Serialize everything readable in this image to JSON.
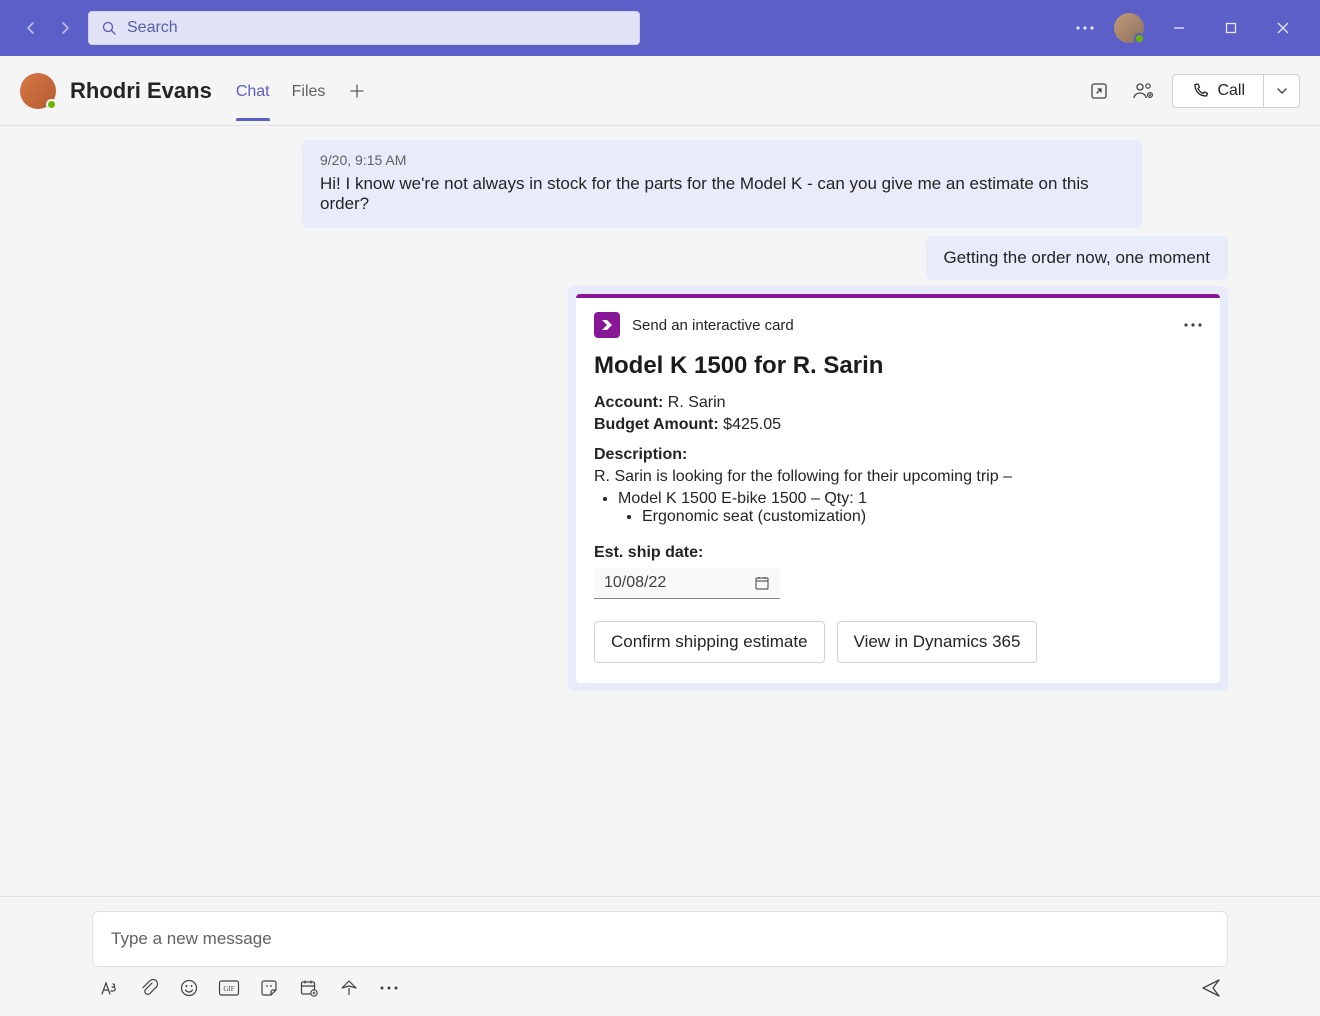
{
  "titlebar": {
    "search_placeholder": "Search"
  },
  "header": {
    "title": "Rhodri Evans",
    "tabs": {
      "chat": "Chat",
      "files": "Files"
    },
    "call_label": "Call"
  },
  "messages": {
    "incoming": {
      "timestamp": "9/20, 9:15 AM",
      "body": "Hi! I know we're not always in stock for the parts for the Model K - can you give me an estimate on this order?"
    },
    "outgoing": {
      "body": "Getting the order now, one moment"
    }
  },
  "card": {
    "sender": "Send an interactive card",
    "title": "Model K 1500 for R. Sarin",
    "account_label": "Account:",
    "account_value": "R. Sarin",
    "budget_label": "Budget Amount:",
    "budget_value": "$425.05",
    "description_label": "Description:",
    "description_text": "R. Sarin is looking for the following for their upcoming trip –",
    "line_item": "Model K 1500 E-bike 1500 – Qty: 1",
    "sub_item": "Ergonomic seat (customization)",
    "ship_label": "Est. ship date:",
    "ship_date": "10/08/22",
    "confirm_button": "Confirm shipping estimate",
    "view_button": "View in Dynamics 365"
  },
  "compose": {
    "placeholder": "Type a new message"
  }
}
